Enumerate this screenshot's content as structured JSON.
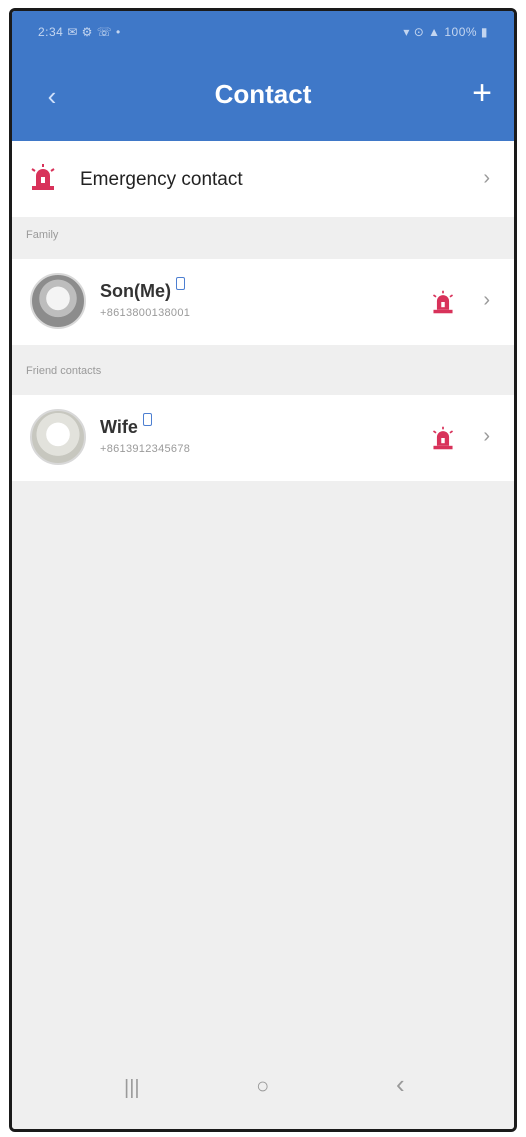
{
  "status_bar": {
    "left": "2:34 ✉ ⚙ ☏ •",
    "right": "▾ ⊙ ▲ 100% ▮"
  },
  "header": {
    "title": "Contact",
    "back_icon": "chevron-left-icon",
    "add_icon": "plus-icon",
    "color": "#3f78c8"
  },
  "emergency": {
    "label": "Emergency contact",
    "icon": "alarm-icon",
    "accent_color": "#d8325a"
  },
  "sections": [
    {
      "label": "Family",
      "contacts": [
        {
          "name": "Son(Me)",
          "number": "+8613800138001"
        }
      ]
    },
    {
      "label": "Friend contacts",
      "contacts": [
        {
          "name": "Wife",
          "number": "+8613912345678"
        }
      ]
    }
  ],
  "bottom_nav": {
    "recent": "|||",
    "home": "○",
    "back": "‹"
  }
}
